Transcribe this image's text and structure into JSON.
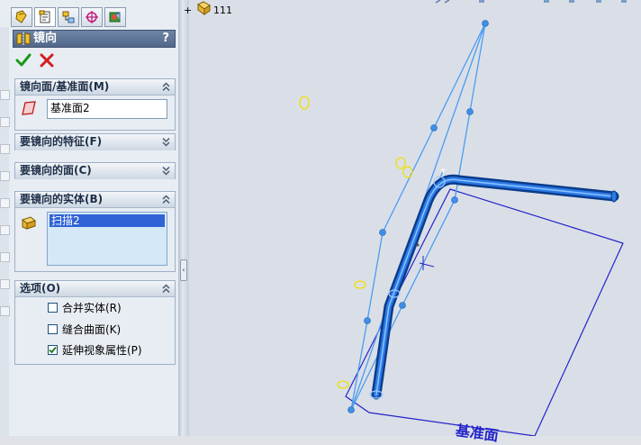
{
  "panel": {
    "tabs": [
      "feature-manager-icon",
      "property-manager-icon",
      "configuration-manager-icon",
      "dimxpert-icon",
      "display-manager-icon"
    ],
    "title": "镜向",
    "help": "?",
    "ok_icon": "check-icon",
    "cancel_icon": "close-icon",
    "groups": {
      "mirror_face": {
        "label": "镜向面/基准面(M)",
        "value": "基准面2",
        "state": "expanded"
      },
      "features": {
        "label": "要镜向的特征(F)",
        "state": "collapsed"
      },
      "faces": {
        "label": "要镜向的面(C)",
        "state": "collapsed"
      },
      "bodies": {
        "label": "要镜向的实体(B)",
        "selected_item": "扫描2",
        "state": "expanded"
      },
      "options": {
        "label": "选项(O)",
        "state": "expanded",
        "items": [
          {
            "label": "合并实体(R)",
            "checked": false
          },
          {
            "label": "缝合曲面(K)",
            "checked": false
          },
          {
            "label": "延伸视象属性(P)",
            "checked": true
          }
        ]
      }
    }
  },
  "viewport": {
    "tree_expand": "+",
    "tree_label": "111",
    "plane_label": "基准面",
    "colors": {
      "background": "#dadfe7",
      "plane": "#2424c8",
      "sketch": "#4a9cf2",
      "sweep": "#0d5fd0",
      "ellipse": "#f0e000"
    }
  }
}
